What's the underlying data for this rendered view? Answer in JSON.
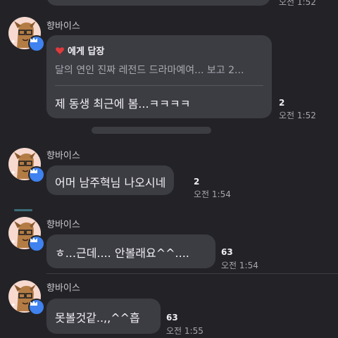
{
  "top_partial": {
    "time": "오전 1:52"
  },
  "messages": [
    {
      "sender": "향바이스",
      "reply": {
        "heading": "에게 답장",
        "quote": "달의 연인 진짜 레전드 드라마예여... 보고 2..."
      },
      "text": "제 동생 최근에 봄...ㅋㅋㅋㅋ",
      "count": "2",
      "time": "오전 1:52"
    },
    {
      "sender": "향바이스",
      "text": "어머 남주혁님 나오시네",
      "count": "2",
      "time": "오전 1:54"
    },
    {
      "sender": "향바이스",
      "text": "ㅎ...근데.... 안볼래요^^....",
      "count": "63",
      "time": "오전 1:54"
    },
    {
      "sender": "향바이스",
      "text": "못볼것같..,,^^흡",
      "count": "63",
      "time": "오전 1:55"
    }
  ],
  "colors": {
    "background": "#232327",
    "bubble": "#3c3c43",
    "badge": "#3f82f0",
    "heart": "#e23a3a"
  },
  "icons": [
    "red-heart-icon",
    "crown-icon"
  ]
}
